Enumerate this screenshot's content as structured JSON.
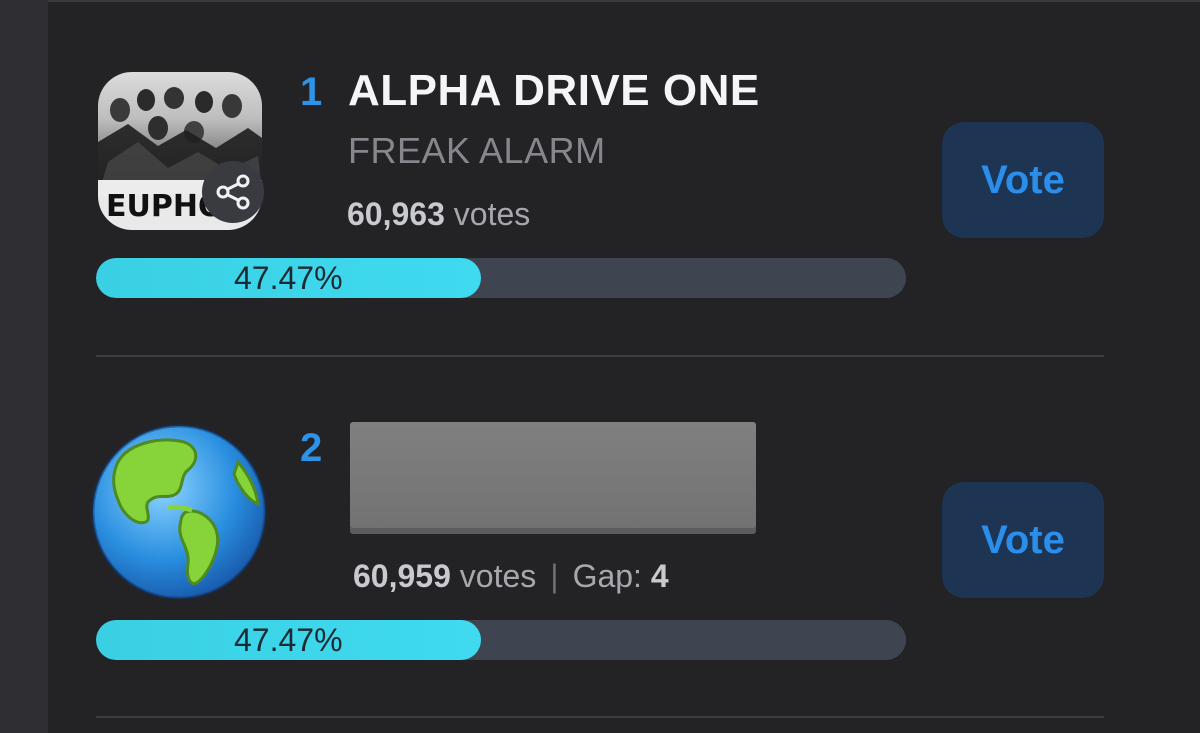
{
  "entries": [
    {
      "rank": "1",
      "title": "ALPHA DRIVE ONE",
      "song": "FREAK ALARM",
      "votes_number": "60,963",
      "votes_word": "votes",
      "percent_label": "47.47%",
      "percent_value": 47.47,
      "vote_label": "Vote",
      "avatar_text": "EUPHO"
    },
    {
      "rank": "2",
      "votes_number": "60,959",
      "votes_word": "votes",
      "separator": "|",
      "gap_label": "Gap:",
      "gap_value": "4",
      "percent_label": "47.47%",
      "percent_value": 47.47,
      "vote_label": "Vote",
      "avatar_icon": "earth-globe-icon"
    }
  ],
  "colors": {
    "rank": "#2c93e8",
    "progress_fill": "#3ad0e3",
    "progress_track": "#3e4550",
    "vote_button_bg": "#1d3453",
    "vote_button_text": "#2a8eea"
  }
}
